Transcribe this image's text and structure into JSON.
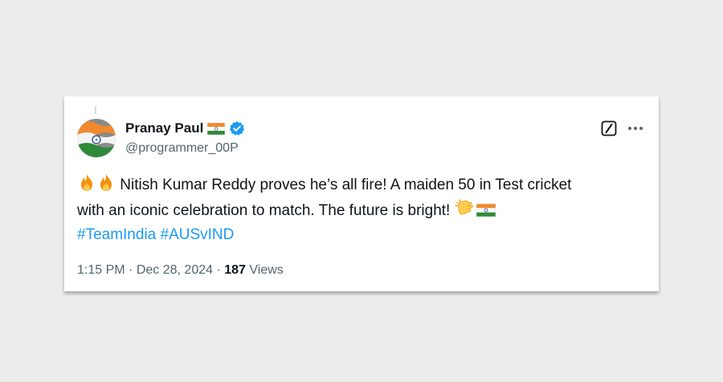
{
  "user": {
    "display_name": "Pranay Paul",
    "handle": "@programmer_00P",
    "name_emoji": "indian-flag",
    "verified_icon": "verified-badge-icon"
  },
  "tweet": {
    "lead_emojis": [
      "fire",
      "fire"
    ],
    "line1": "Nitish Kumar Reddy proves he’s all fire! A maiden 50 in Test cricket",
    "line2": "with an iconic celebration to match. The future is bright!",
    "trail_emojis": [
      "clapping-hands",
      "indian-flag"
    ],
    "hashtags": [
      "#TeamIndia",
      "#AUSvIND"
    ]
  },
  "meta": {
    "time": "1:15 PM",
    "separator": "·",
    "date": "Dec 28, 2024",
    "views_count": "187",
    "views_label": "Views"
  },
  "colors": {
    "text": "#0f1419",
    "secondary": "#536471",
    "link": "#1d9bf0",
    "verified": "#1d9bf0",
    "page_background": "#ececec"
  }
}
